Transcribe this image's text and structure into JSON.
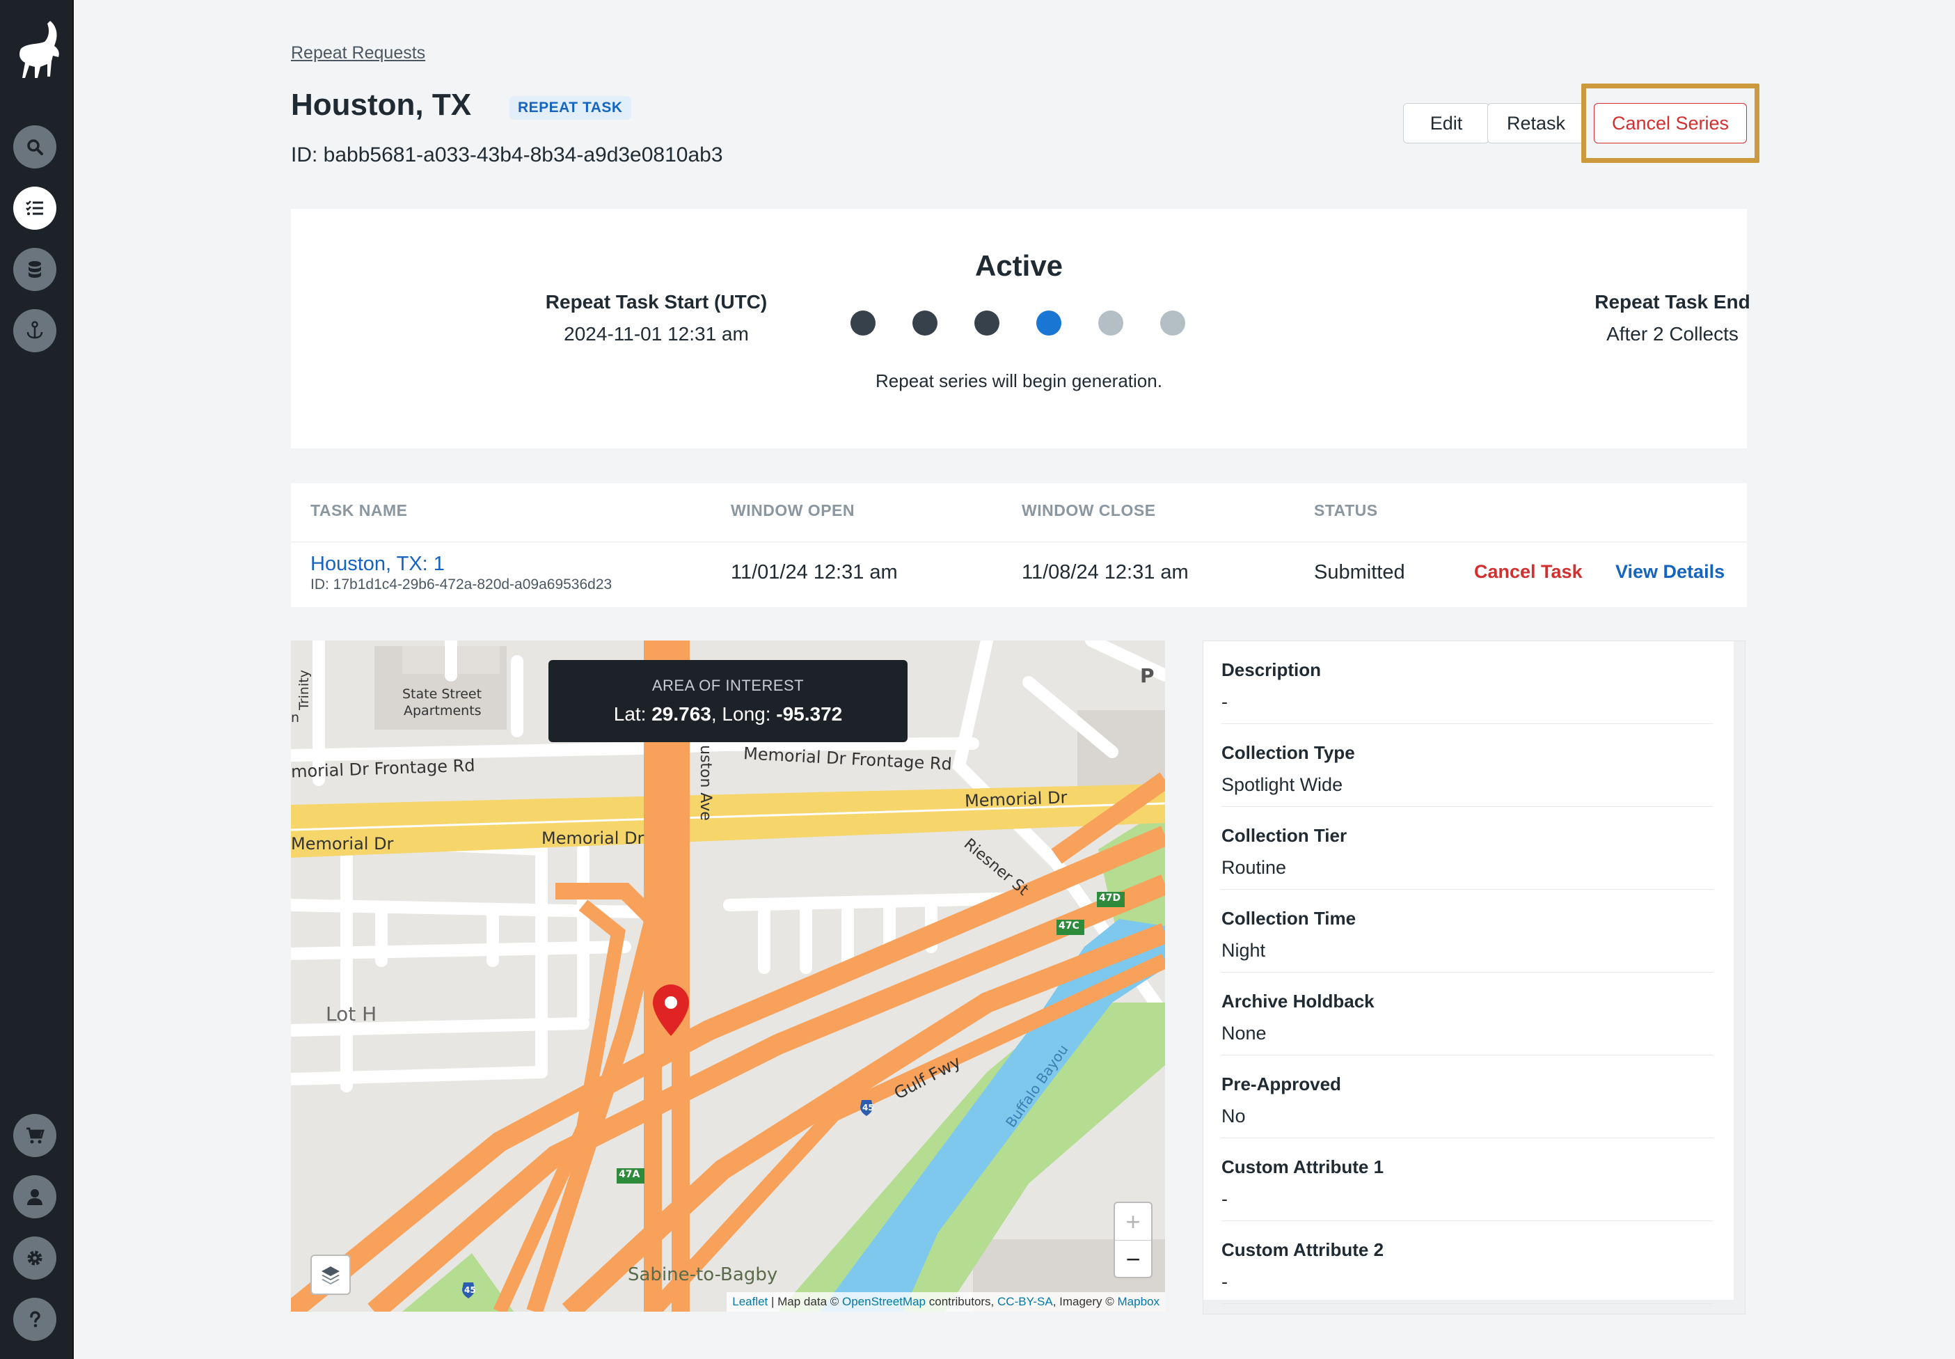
{
  "breadcrumb": "Repeat Requests",
  "header": {
    "title": "Houston, TX",
    "badge": "REPEAT TASK",
    "id_text": "ID: babb5681-a033-43b4-8b34-a9d3e0810ab3",
    "edit_label": "Edit",
    "retask_label": "Retask",
    "cancel_series_label": "Cancel Series"
  },
  "sidebar": {
    "icons": [
      "ibex-logo",
      "search-icon",
      "task-list-icon",
      "database-icon",
      "anchor-icon",
      "cart-icon",
      "user-icon",
      "gear-icon",
      "help-icon"
    ],
    "active": "task-list-icon"
  },
  "status": {
    "title": "Active",
    "start_label": "Repeat Task Start (UTC)",
    "start_value": "2024-11-01 12:31 am",
    "end_label": "Repeat Task End",
    "end_value": "After 2 Collects",
    "message": "Repeat series will begin generation.",
    "steps": [
      "done",
      "done",
      "done",
      "current",
      "pending",
      "pending"
    ],
    "colors": {
      "done": "#36414b",
      "current": "#1976d2",
      "pending": "#b4bec5"
    }
  },
  "table": {
    "headers": [
      "TASK NAME",
      "WINDOW OPEN",
      "WINDOW CLOSE",
      "STATUS"
    ],
    "rows": [
      {
        "name": "Houston, TX: 1",
        "id": "ID: 17b1d1c4-29b6-472a-820d-a09a69536d23",
        "window_open": "11/01/24 12:31 am",
        "window_close": "11/08/24 12:31 am",
        "status": "Submitted",
        "cancel_label": "Cancel Task",
        "view_label": "View Details"
      }
    ]
  },
  "map": {
    "aoi_title": "AREA OF INTEREST",
    "lat_prefix": "Lat: ",
    "lat": "29.763",
    "long_prefix": ", Long: ",
    "long": "-95.372",
    "labels": {
      "state_street_1": "State Street",
      "state_street_2": "Apartments",
      "trinity": "Trinity",
      "memorial_frontage_left": "morial Dr Frontage Rd",
      "memorial_frontage_right": "Memorial Dr Frontage Rd",
      "memorial_left": "Memorial Dr",
      "memorial_mid": "Memorial Dr",
      "memorial_right": "Memorial Dr",
      "houston_ave": "uston Ave",
      "riesner": "Riesner St",
      "lot_h": "Lot H",
      "gulf_fwy": "Gulf Fwy",
      "buffalo_bayou": "Buffalo Bayou",
      "sabine": "Sabine-to-Bagby",
      "parking": "P",
      "exit_47d": "47D",
      "exit_47c": "47C",
      "exit_47a": "47A",
      "i45": "45",
      "left_n": "n"
    },
    "zoom_in": "+",
    "zoom_out": "−",
    "attribution": {
      "leaflet": "Leaflet",
      "sep1": " | Map data © ",
      "osm": "OpenStreetMap",
      "sep2": " contributors, ",
      "ccbysa": "CC-BY-SA",
      "sep3": ", Imagery © ",
      "mapbox": "Mapbox"
    },
    "colors": {
      "highway": "#f8a15a",
      "major": "#f6d56b",
      "water": "#7ec8ee",
      "park": "#b4dd92",
      "land": "#e8e6e3",
      "building": "#d9d6d2"
    }
  },
  "details": [
    {
      "label": "Description",
      "value": "-"
    },
    {
      "label": "Collection Type",
      "value": "Spotlight Wide"
    },
    {
      "label": "Collection Tier",
      "value": "Routine"
    },
    {
      "label": "Collection Time",
      "value": "Night"
    },
    {
      "label": "Archive Holdback",
      "value": "None"
    },
    {
      "label": "Pre-Approved",
      "value": "No"
    },
    {
      "label": "Custom Attribute 1",
      "value": "-"
    },
    {
      "label": "Custom Attribute 2",
      "value": "-"
    }
  ],
  "accent": "#1565c0",
  "danger": "#d32f2f",
  "highlight": "#cc9a3d"
}
